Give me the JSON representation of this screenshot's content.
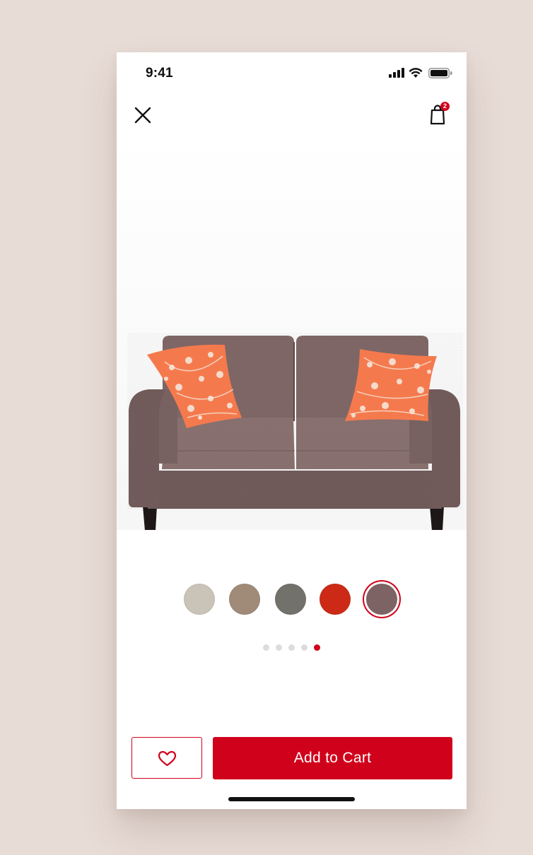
{
  "status_bar": {
    "time": "9:41"
  },
  "nav": {
    "cart_count": "2"
  },
  "colors": {
    "accent": "#d0021b",
    "background": "#e8dcd6",
    "sofa": "#7f6866",
    "pillow": "#f47a4e"
  },
  "icons": {
    "close": "close-icon",
    "bag": "shopping-bag-icon",
    "heart": "heart-icon",
    "signal": "signal-icon",
    "wifi": "wifi-icon",
    "battery": "battery-icon"
  },
  "swatches": [
    {
      "name": "light-grey",
      "color": "#c9c3b8",
      "selected": false
    },
    {
      "name": "tan",
      "color": "#a08a78",
      "selected": false
    },
    {
      "name": "grey",
      "color": "#72716c",
      "selected": false
    },
    {
      "name": "red",
      "color": "#cc2a17",
      "selected": false
    },
    {
      "name": "mauve",
      "color": "#7d6363",
      "selected": true
    }
  ],
  "gallery": {
    "total_images": 5,
    "current_image": 5
  },
  "actions": {
    "add_to_cart": "Add to Cart"
  }
}
